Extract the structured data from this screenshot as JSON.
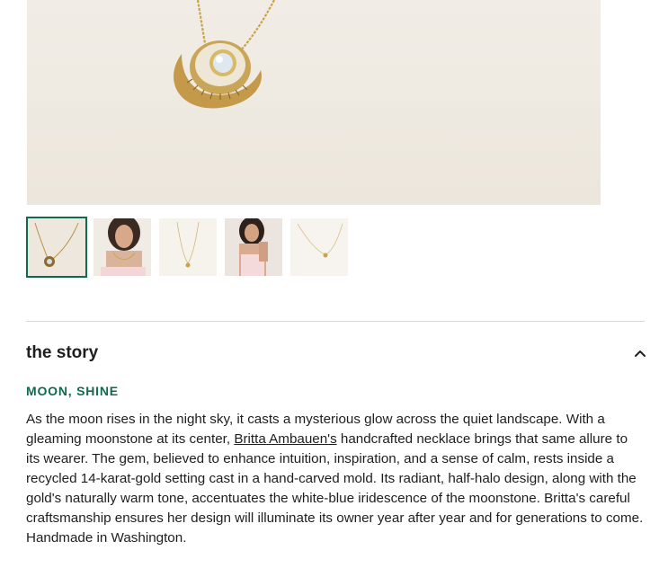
{
  "gallery": {
    "main_image_alt": "gold pendant necklace with moonstone",
    "thumbnails": [
      {
        "label": "pendant close-up",
        "selected": true
      },
      {
        "label": "model wearing necklace",
        "selected": false
      },
      {
        "label": "necklace full length",
        "selected": false
      },
      {
        "label": "model with necklace",
        "selected": false
      },
      {
        "label": "necklace detail",
        "selected": false
      }
    ]
  },
  "story": {
    "title": "the story",
    "expanded": true,
    "subheading": "MOON, SHINE",
    "text_before_link": "As the moon rises in the night sky, it casts a mysterious glow across the quiet landscape. With a gleaming moonstone at its center, ",
    "link_text": "Britta Ambauen's",
    "text_after_link": " handcrafted necklace brings that same allure to its wearer. The gem, believed to enhance intuition, inspiration, and a sense of calm, rests inside a recycled 14-karat-gold setting cast in a hand-carved mold. Its radiant, half-halo design, along with the gold's naturally warm tone, accentuates the white-blue iridescence of the moonstone. Britta's careful craftsmanship ensures her design will illuminate its owner year after year and for generations to come. Handmade in Washington."
  },
  "colors": {
    "accent": "#0f6b4e",
    "text": "#1e1e1e",
    "divider": "#d9d9d9"
  },
  "icons": {
    "collapse": "chevron-up-icon"
  }
}
